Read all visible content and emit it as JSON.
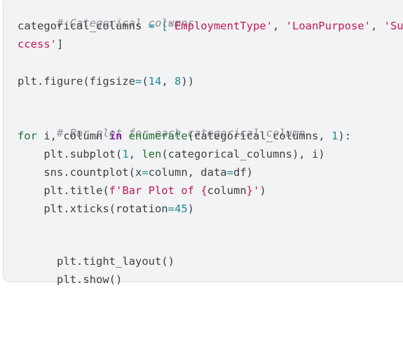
{
  "code": {
    "line_1": "# Categorical columns",
    "line_2": {
      "a": "categorical_columns",
      "b": " = [",
      "c": "'EmploymentType'",
      "d": ", ",
      "e": "'LoanPurpose'",
      "f": ", ",
      "g": "'Su"
    },
    "line_3": {
      "a": "ccess'",
      "b": "]"
    },
    "line_5": {
      "a": "plt.figure(figsize",
      "b": "=",
      "c": "(",
      "d": "14",
      "e": ", ",
      "f": "8",
      "g": "))"
    },
    "line_7": "# Bar plot for each categorical column",
    "line_8": {
      "a": "for",
      "b": " i, column ",
      "c": "in",
      "d": " ",
      "e": "enumerate",
      "f": "(categorical_columns, ",
      "g": "1",
      "h": "):"
    },
    "line_9": {
      "a": "    plt.subplot(",
      "b": "1",
      "c": ", ",
      "d": "len",
      "e": "(categorical_columns), i)"
    },
    "line_10": {
      "a": "    sns.countplot(x",
      "b": "=",
      "c": "column, data",
      "d": "=",
      "e": "df)"
    },
    "line_11": {
      "a": "    plt.title(",
      "b": "f'Bar Plot of ",
      "c": "{",
      "d": "column",
      "e": "}",
      "f": "'",
      "g": ")"
    },
    "line_12": {
      "a": "    plt.xticks(rotation",
      "b": "=",
      "c": "45",
      "d": ")"
    },
    "line_14": "plt.tight_layout()",
    "line_15": "plt.show()"
  }
}
